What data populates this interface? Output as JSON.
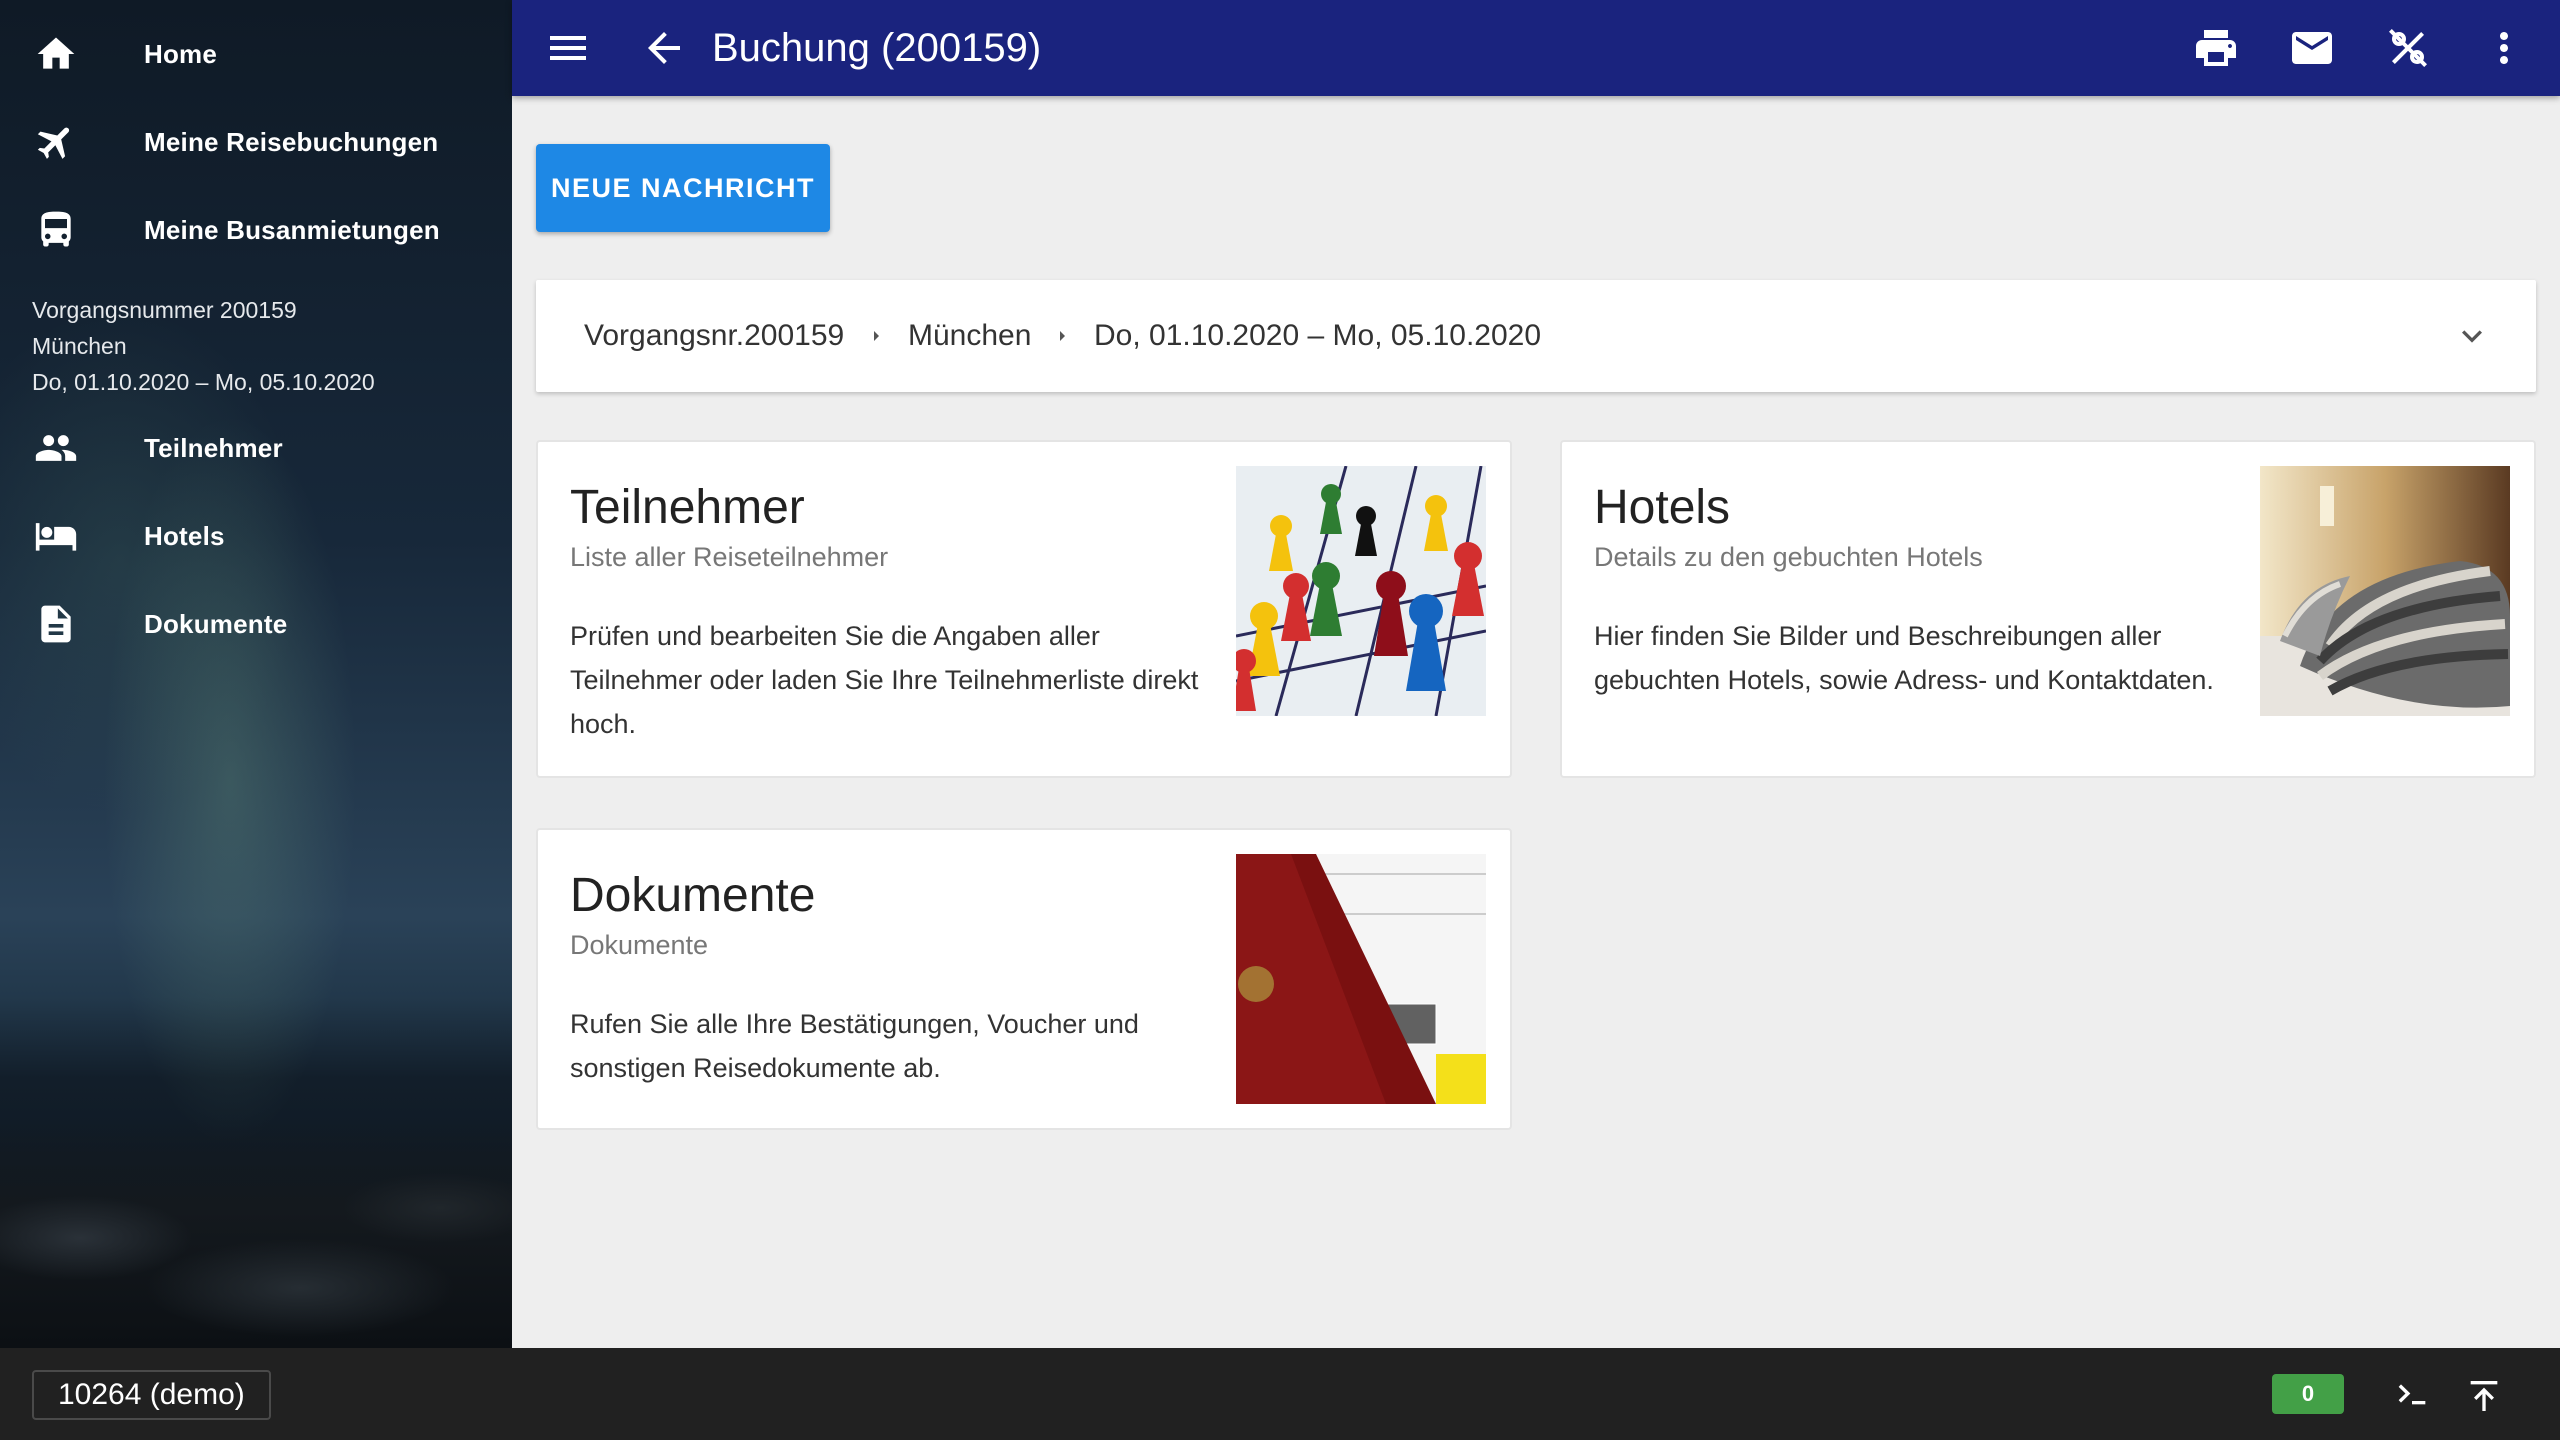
{
  "sidebar": {
    "items": [
      {
        "label": "Home",
        "icon": "home-icon"
      },
      {
        "label": "Meine Reisebuchungen",
        "icon": "airplane-icon"
      },
      {
        "label": "Meine Busanmietungen",
        "icon": "bus-icon"
      }
    ],
    "booking_info": {
      "line1": "Vorgangsnummer 200159",
      "line2": "München",
      "line3": "Do, 01.10.2020 – Mo, 05.10.2020"
    },
    "sub_items": [
      {
        "label": "Teilnehmer",
        "icon": "people-icon"
      },
      {
        "label": "Hotels",
        "icon": "bed-icon"
      },
      {
        "label": "Dokumente",
        "icon": "document-icon"
      }
    ]
  },
  "header": {
    "title": "Buchung (200159)"
  },
  "actions": {
    "new_message": "NEUE NACHRICHT"
  },
  "breadcrumb": {
    "items": [
      "Vorgangsnr.200159",
      "München",
      "Do, 01.10.2020 – Mo, 05.10.2020"
    ]
  },
  "cards": [
    {
      "title": "Teilnehmer",
      "subtitle": "Liste aller Reiseteilnehmer",
      "body": "Prüfen und bearbeiten Sie die Angaben aller Teilnehmer oder laden Sie Ihre Teilnehmerliste direkt hoch."
    },
    {
      "title": "Hotels",
      "subtitle": "Details zu den gebuchten Hotels",
      "body": "Hier finden Sie Bilder und Beschreibungen aller gebuchten Hotels, sowie Adress- und Kontaktdaten."
    },
    {
      "title": "Dokumente",
      "subtitle": "Dokumente",
      "body": "Rufen Sie alle Ihre Bestätigungen, Voucher und sonstigen Reisedokumente ab."
    }
  ],
  "footer": {
    "account": "10264 (demo)",
    "badge_count": "0"
  },
  "colors": {
    "appbar": "#1a237e",
    "primary_button": "#1e88e5",
    "badge": "#43a047",
    "footer": "#212121"
  }
}
